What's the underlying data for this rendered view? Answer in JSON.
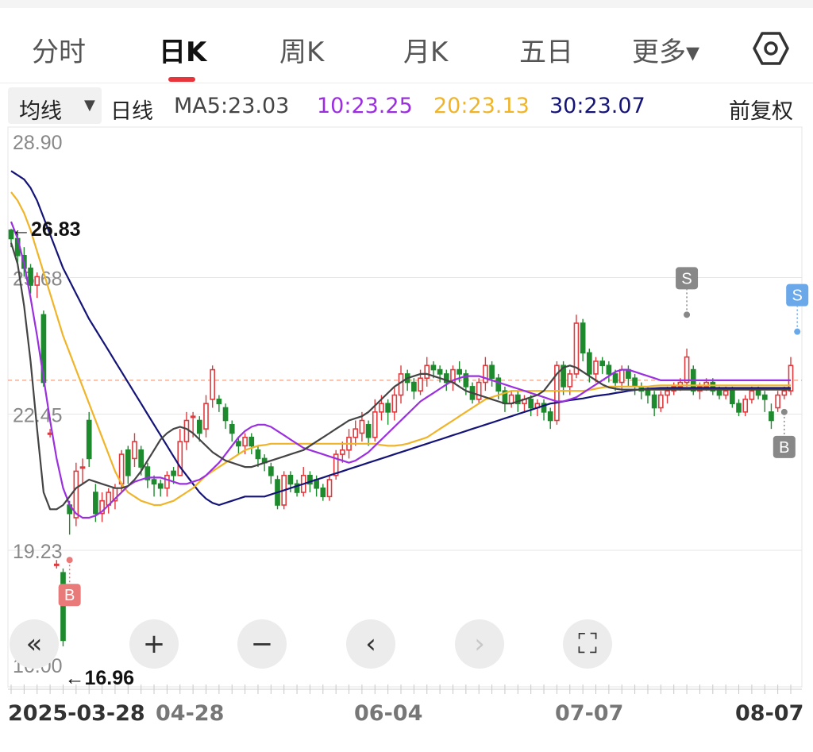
{
  "tabs": [
    {
      "label": "分时"
    },
    {
      "label": "日K"
    },
    {
      "label": "周K"
    },
    {
      "label": "月K"
    },
    {
      "label": "五日"
    },
    {
      "label": "更多▾"
    }
  ],
  "active_tab": "日K",
  "settings_icon": "hexagon-gear-icon",
  "ma_bar": {
    "select_label": "均线",
    "period": "日线",
    "ma5": "MA5:23.03",
    "ma10": "10:23.25",
    "ma20": "20:23.13",
    "ma30": "30:23.07",
    "adjust": "前复权"
  },
  "colors": {
    "up": "#e03a3e",
    "down": "#1e8a2e",
    "ma5": "#444444",
    "ma10": "#9b2fe0",
    "ma20": "#f0b428",
    "ma30": "#141478",
    "ref_line": "#f0a080",
    "sell_gray": "#888888",
    "sell_blue": "#6aa8ea",
    "buy_red": "#e87a7a"
  },
  "controls": {
    "rewind": "«",
    "zoom_in": "+",
    "zoom_out": "−",
    "prev": "‹",
    "next": "›",
    "fullscreen": "⛶"
  },
  "chart_data": {
    "type": "candlestick",
    "y_ticks": [
      "28.90",
      "25.68",
      "22.45",
      "19.23",
      "16.00"
    ],
    "ylim": [
      16.0,
      28.9
    ],
    "max_marker": "←26.83",
    "min_marker": "←16.96",
    "last_price": 23.25,
    "x_labels": [
      "2025-03-28",
      "04-28",
      "06-04",
      "07-07",
      "08-07"
    ],
    "markers": [
      {
        "label": "B",
        "index": 9,
        "price": 19.0,
        "kind": "buy"
      },
      {
        "label": "S",
        "index": 104,
        "price": 24.8,
        "kind": "sell"
      },
      {
        "label": "B",
        "index": 119,
        "price": 22.5,
        "kind": "buy-gray"
      },
      {
        "label": "S",
        "index": 121,
        "price": 24.4,
        "kind": "sell-blue"
      }
    ],
    "series": [
      {
        "name": "MA30",
        "values": [
          28.2,
          28.1,
          28.0,
          27.8,
          27.5,
          27.1,
          26.7,
          26.3,
          25.9,
          25.6,
          25.3,
          25.0,
          24.7,
          24.45,
          24.2,
          23.95,
          23.7,
          23.45,
          23.2,
          22.95,
          22.7,
          22.45,
          22.2,
          21.95,
          21.7,
          21.45,
          21.2,
          21.0,
          20.8,
          20.6,
          20.45,
          20.35,
          20.3,
          20.35,
          20.4,
          20.45,
          20.5,
          20.5,
          20.5,
          20.5,
          20.55,
          20.6,
          20.65,
          20.7,
          20.75,
          20.8,
          20.85,
          20.9,
          20.95,
          21.0,
          21.05,
          21.1,
          21.15,
          21.2,
          21.25,
          21.3,
          21.35,
          21.4,
          21.45,
          21.5,
          21.55,
          21.6,
          21.65,
          21.7,
          21.75,
          21.8,
          21.85,
          21.9,
          21.95,
          22.0,
          22.05,
          22.1,
          22.15,
          22.2,
          22.25,
          22.3,
          22.35,
          22.4,
          22.45,
          22.5,
          22.55,
          22.6,
          22.65,
          22.7,
          22.72,
          22.75,
          22.78,
          22.8,
          22.82,
          22.85,
          22.88,
          22.9,
          22.92,
          22.95,
          22.97,
          23.0,
          23.02,
          23.04,
          23.05,
          23.06,
          23.07,
          23.07,
          23.07,
          23.07,
          23.07,
          23.07,
          23.07,
          23.07,
          23.07,
          23.07,
          23.07,
          23.07,
          23.07,
          23.07,
          23.07,
          23.07,
          23.07,
          23.07,
          23.07,
          23.07,
          23.07,
          23.07,
          23.07
        ]
      },
      {
        "name": "MA20",
        "values": [
          27.7,
          27.5,
          27.2,
          26.8,
          26.3,
          25.8,
          25.3,
          24.8,
          24.3,
          23.9,
          23.5,
          23.1,
          22.7,
          22.3,
          21.9,
          21.5,
          21.1,
          20.8,
          20.6,
          20.5,
          20.4,
          20.35,
          20.3,
          20.3,
          20.35,
          20.4,
          20.5,
          20.6,
          20.7,
          20.85,
          21.0,
          21.1,
          21.2,
          21.3,
          21.4,
          21.5,
          21.6,
          21.65,
          21.7,
          21.72,
          21.75,
          21.75,
          21.75,
          21.75,
          21.75,
          21.75,
          21.75,
          21.75,
          21.75,
          21.75,
          21.75,
          21.75,
          21.75,
          21.75,
          21.75,
          21.75,
          21.75,
          21.72,
          21.7,
          21.7,
          21.72,
          21.75,
          21.8,
          21.85,
          21.9,
          22.0,
          22.1,
          22.2,
          22.3,
          22.4,
          22.5,
          22.6,
          22.7,
          22.8,
          22.85,
          22.9,
          22.95,
          23.0,
          23.0,
          23.0,
          23.0,
          23.0,
          23.0,
          23.0,
          23.0,
          23.0,
          23.0,
          23.0,
          23.0,
          23.02,
          23.05,
          23.08,
          23.1,
          23.1,
          23.1,
          23.1,
          23.1,
          23.1,
          23.1,
          23.12,
          23.13,
          23.13,
          23.13,
          23.13,
          23.13,
          23.13,
          23.13,
          23.13,
          23.13,
          23.13,
          23.13,
          23.13,
          23.13,
          23.13,
          23.13,
          23.13,
          23.13,
          23.13,
          23.13,
          23.13,
          23.13,
          23.13,
          23.13
        ]
      },
      {
        "name": "MA10",
        "values": [
          27.0,
          26.6,
          26.0,
          25.2,
          24.3,
          23.3,
          22.3,
          21.4,
          20.7,
          20.3,
          20.1,
          20.0,
          20.0,
          20.05,
          20.15,
          20.3,
          20.45,
          20.6,
          20.75,
          20.85,
          20.9,
          20.95,
          20.95,
          20.95,
          20.9,
          20.85,
          20.8,
          20.8,
          20.85,
          20.9,
          21.0,
          21.15,
          21.3,
          21.5,
          21.7,
          21.9,
          22.05,
          22.15,
          22.2,
          22.2,
          22.15,
          22.05,
          21.95,
          21.85,
          21.75,
          21.65,
          21.6,
          21.55,
          21.5,
          21.45,
          21.4,
          21.35,
          21.3,
          21.35,
          21.45,
          21.55,
          21.7,
          21.85,
          22.0,
          22.15,
          22.3,
          22.45,
          22.6,
          22.75,
          22.85,
          22.95,
          23.05,
          23.15,
          23.25,
          23.3,
          23.35,
          23.35,
          23.35,
          23.3,
          23.25,
          23.2,
          23.15,
          23.1,
          23.05,
          23.0,
          22.95,
          22.9,
          22.85,
          22.8,
          22.75,
          22.75,
          22.8,
          22.85,
          22.95,
          23.05,
          23.15,
          23.25,
          23.35,
          23.45,
          23.5,
          23.5,
          23.45,
          23.4,
          23.35,
          23.3,
          23.25,
          23.25,
          23.25,
          23.25,
          23.25,
          23.25,
          23.25,
          23.25,
          23.25,
          23.25,
          23.25,
          23.25,
          23.25,
          23.25,
          23.25,
          23.25,
          23.25,
          23.25,
          23.25,
          23.25,
          23.25,
          23.25,
          23.25
        ]
      },
      {
        "name": "MA5",
        "values": [
          26.5,
          26.0,
          25.0,
          23.7,
          22.1,
          20.6,
          20.2,
          20.2,
          20.3,
          20.5,
          20.7,
          20.8,
          20.9,
          20.85,
          20.8,
          20.75,
          20.7,
          20.7,
          20.75,
          20.9,
          21.1,
          21.35,
          21.6,
          21.85,
          22.0,
          22.1,
          22.15,
          22.1,
          22.0,
          21.85,
          21.7,
          21.55,
          21.45,
          21.35,
          21.3,
          21.25,
          21.2,
          21.2,
          21.25,
          21.3,
          21.35,
          21.4,
          21.45,
          21.5,
          21.55,
          21.6,
          21.7,
          21.8,
          21.9,
          22.0,
          22.1,
          22.2,
          22.3,
          22.35,
          22.4,
          22.5,
          22.65,
          22.8,
          22.95,
          23.1,
          23.2,
          23.3,
          23.35,
          23.4,
          23.4,
          23.35,
          23.3,
          23.25,
          23.2,
          23.1,
          23.0,
          22.95,
          22.9,
          22.85,
          22.8,
          22.75,
          22.7,
          22.7,
          22.75,
          22.8,
          22.85,
          22.9,
          23.0,
          23.2,
          23.4,
          23.55,
          23.6,
          23.55,
          23.45,
          23.35,
          23.25,
          23.15,
          23.08,
          23.05,
          23.03,
          23.03,
          23.03,
          23.03,
          23.03,
          23.03,
          23.03,
          23.03,
          23.03,
          23.03,
          23.03,
          23.03,
          23.03,
          23.03,
          23.03,
          23.03,
          23.03,
          23.03,
          23.03,
          23.03,
          23.03,
          23.03,
          23.03,
          23.03,
          23.03,
          23.03,
          23.03,
          23.03,
          23.03
        ]
      }
    ],
    "candles": [
      [
        26.8,
        26.6,
        26.83,
        26.4
      ],
      [
        26.6,
        26.2,
        26.7,
        26.0
      ],
      [
        26.2,
        25.9,
        26.4,
        25.7
      ],
      [
        25.9,
        25.5,
        26.0,
        25.3
      ],
      [
        25.5,
        25.7,
        25.8,
        25.2
      ],
      [
        24.8,
        23.2,
        24.9,
        23.1
      ],
      [
        22.0,
        22.0,
        22.1,
        21.9
      ],
      [
        18.9,
        18.9,
        19.0,
        18.8
      ],
      [
        18.7,
        17.1,
        18.8,
        16.96
      ],
      [
        20.3,
        20.1,
        20.4,
        19.6
      ],
      [
        20.0,
        21.1,
        21.3,
        19.8
      ],
      [
        21.2,
        21.2,
        21.4,
        20.8
      ],
      [
        22.3,
        21.4,
        22.5,
        21.2
      ],
      [
        20.6,
        20.1,
        20.8,
        19.9
      ],
      [
        20.1,
        20.4,
        20.6,
        19.9
      ],
      [
        20.3,
        20.6,
        20.7,
        20.1
      ],
      [
        20.4,
        20.7,
        20.8,
        20.2
      ],
      [
        20.8,
        21.5,
        21.6,
        20.6
      ],
      [
        21.6,
        21.0,
        21.7,
        20.8
      ],
      [
        21.4,
        21.8,
        22.0,
        21.2
      ],
      [
        21.6,
        21.2,
        21.7,
        21.0
      ],
      [
        21.2,
        20.9,
        21.3,
        20.7
      ],
      [
        20.9,
        20.8,
        21.0,
        20.5
      ],
      [
        20.8,
        20.7,
        20.9,
        20.5
      ],
      [
        20.7,
        21.0,
        21.1,
        20.5
      ],
      [
        21.1,
        21.0,
        21.2,
        20.8
      ],
      [
        21.0,
        21.8,
        22.1,
        21.0
      ],
      [
        21.8,
        22.3,
        22.5,
        21.6
      ],
      [
        22.4,
        22.4,
        22.5,
        21.9
      ],
      [
        22.3,
        22.0,
        22.4,
        21.8
      ],
      [
        22.1,
        22.7,
        22.9,
        21.9
      ],
      [
        22.8,
        23.5,
        23.6,
        22.6
      ],
      [
        22.8,
        22.7,
        22.9,
        22.5
      ],
      [
        22.6,
        22.3,
        22.7,
        22.1
      ],
      [
        22.2,
        22.0,
        22.3,
        21.8
      ],
      [
        21.8,
        21.7,
        21.9,
        21.5
      ],
      [
        21.7,
        21.9,
        22.0,
        21.5
      ],
      [
        21.9,
        21.7,
        22.0,
        21.5
      ],
      [
        21.6,
        21.4,
        21.7,
        21.2
      ],
      [
        21.4,
        21.3,
        21.5,
        21.1
      ],
      [
        21.2,
        21.0,
        21.3,
        20.8
      ],
      [
        20.9,
        20.3,
        21.0,
        20.2
      ],
      [
        20.3,
        21.0,
        21.1,
        20.2
      ],
      [
        21.0,
        20.8,
        21.1,
        20.6
      ],
      [
        20.8,
        20.6,
        20.9,
        20.5
      ],
      [
        20.6,
        21.0,
        21.2,
        20.5
      ],
      [
        21.0,
        20.8,
        21.1,
        20.6
      ],
      [
        20.9,
        20.7,
        21.0,
        20.5
      ],
      [
        20.7,
        20.5,
        20.8,
        20.4
      ],
      [
        20.5,
        20.9,
        21.0,
        20.4
      ],
      [
        21.0,
        21.5,
        21.6,
        20.9
      ],
      [
        21.5,
        21.6,
        21.8,
        21.3
      ],
      [
        21.6,
        21.9,
        22.1,
        21.4
      ],
      [
        21.9,
        22.1,
        22.3,
        21.7
      ],
      [
        22.0,
        22.3,
        22.5,
        21.8
      ],
      [
        22.2,
        21.9,
        22.3,
        21.7
      ],
      [
        21.9,
        22.5,
        22.8,
        21.8
      ],
      [
        22.5,
        22.7,
        22.9,
        22.3
      ],
      [
        22.7,
        22.5,
        22.8,
        22.2
      ],
      [
        22.5,
        22.9,
        23.1,
        22.3
      ],
      [
        22.9,
        23.4,
        23.6,
        22.7
      ],
      [
        23.4,
        23.2,
        23.5,
        23.0
      ],
      [
        23.2,
        23.0,
        23.3,
        22.8
      ],
      [
        23.0,
        23.3,
        23.5,
        22.9
      ],
      [
        23.3,
        23.6,
        23.8,
        23.1
      ],
      [
        23.6,
        23.5,
        23.7,
        23.3
      ],
      [
        23.5,
        23.4,
        23.6,
        23.2
      ],
      [
        23.4,
        23.2,
        23.5,
        23.0
      ],
      [
        23.2,
        23.5,
        23.6,
        23.0
      ],
      [
        23.5,
        23.4,
        23.7,
        23.2
      ],
      [
        23.4,
        23.1,
        23.5,
        22.9
      ],
      [
        23.1,
        22.8,
        23.2,
        22.7
      ],
      [
        22.8,
        23.2,
        23.3,
        22.7
      ],
      [
        23.2,
        23.6,
        23.8,
        23.0
      ],
      [
        23.6,
        23.3,
        23.7,
        23.1
      ],
      [
        23.3,
        23.0,
        23.4,
        22.8
      ],
      [
        23.0,
        22.7,
        23.1,
        22.5
      ],
      [
        22.7,
        22.9,
        23.0,
        22.6
      ],
      [
        22.9,
        22.7,
        23.0,
        22.5
      ],
      [
        22.7,
        22.8,
        22.9,
        22.5
      ],
      [
        22.8,
        22.6,
        22.9,
        22.4
      ],
      [
        22.6,
        22.7,
        22.8,
        22.4
      ],
      [
        22.7,
        22.5,
        22.8,
        22.3
      ],
      [
        22.5,
        22.3,
        22.6,
        22.1
      ],
      [
        22.3,
        23.6,
        23.7,
        22.2
      ],
      [
        23.6,
        23.1,
        23.7,
        22.9
      ],
      [
        23.1,
        23.4,
        23.5,
        22.9
      ],
      [
        23.4,
        24.6,
        24.8,
        23.3
      ],
      [
        24.6,
        23.9,
        24.7,
        23.7
      ],
      [
        23.9,
        23.4,
        24.0,
        23.2
      ],
      [
        23.4,
        23.7,
        23.8,
        23.2
      ],
      [
        23.7,
        23.6,
        23.8,
        23.4
      ],
      [
        23.6,
        23.4,
        23.7,
        23.2
      ],
      [
        23.4,
        23.2,
        23.5,
        23.0
      ],
      [
        23.2,
        23.5,
        23.6,
        23.0
      ],
      [
        23.5,
        23.3,
        23.6,
        23.1
      ],
      [
        23.3,
        23.1,
        23.4,
        22.9
      ],
      [
        23.1,
        23.0,
        23.2,
        22.8
      ],
      [
        23.0,
        22.9,
        23.1,
        22.7
      ],
      [
        22.9,
        22.6,
        23.0,
        22.4
      ],
      [
        22.6,
        22.9,
        23.0,
        22.5
      ],
      [
        22.9,
        23.0,
        23.1,
        22.7
      ],
      [
        23.0,
        23.1,
        23.2,
        22.9
      ],
      [
        23.1,
        23.2,
        23.3,
        23.0
      ],
      [
        23.2,
        23.8,
        24.0,
        23.1
      ],
      [
        23.5,
        23.0,
        23.6,
        22.9
      ],
      [
        23.0,
        23.1,
        23.2,
        22.8
      ],
      [
        23.1,
        23.2,
        23.3,
        23.0
      ],
      [
        23.2,
        23.0,
        23.3,
        22.9
      ],
      [
        23.0,
        22.9,
        23.1,
        22.8
      ],
      [
        22.9,
        23.0,
        23.1,
        22.8
      ],
      [
        23.0,
        22.7,
        23.1,
        22.6
      ],
      [
        22.7,
        22.5,
        22.8,
        22.4
      ],
      [
        22.5,
        22.8,
        22.9,
        22.4
      ],
      [
        22.8,
        23.0,
        23.1,
        22.7
      ],
      [
        23.0,
        22.9,
        23.1,
        22.8
      ],
      [
        22.9,
        22.8,
        23.0,
        22.5
      ],
      [
        22.5,
        22.3,
        22.7,
        22.1
      ],
      [
        22.6,
        22.9,
        23.0,
        22.5
      ],
      [
        22.9,
        23.0,
        23.1,
        22.8
      ],
      [
        23.0,
        23.6,
        23.8,
        22.9
      ]
    ],
    "candle_fmt": "[open, close, high, low]"
  }
}
